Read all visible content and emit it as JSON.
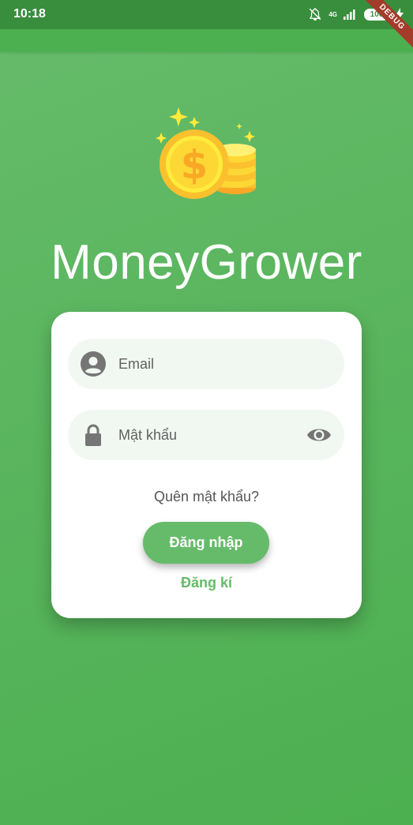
{
  "status_bar": {
    "time": "10:18",
    "network": "4G",
    "battery": "100"
  },
  "debug_banner": "DEBUG",
  "app": {
    "title": "MoneyGrower",
    "logo_icon": "gold-coins-icon"
  },
  "login_form": {
    "email_placeholder": "Email",
    "email_value": "",
    "password_placeholder": "Mật khẩu",
    "password_value": "",
    "forgot_password_label": "Quên mật khẩu?",
    "login_label": "Đăng nhập",
    "register_label": "Đăng kí"
  },
  "colors": {
    "primary": "#4caf50",
    "accent": "#66bb6a",
    "status_bar": "#388e3c",
    "field_bg": "#f1f8f1"
  }
}
